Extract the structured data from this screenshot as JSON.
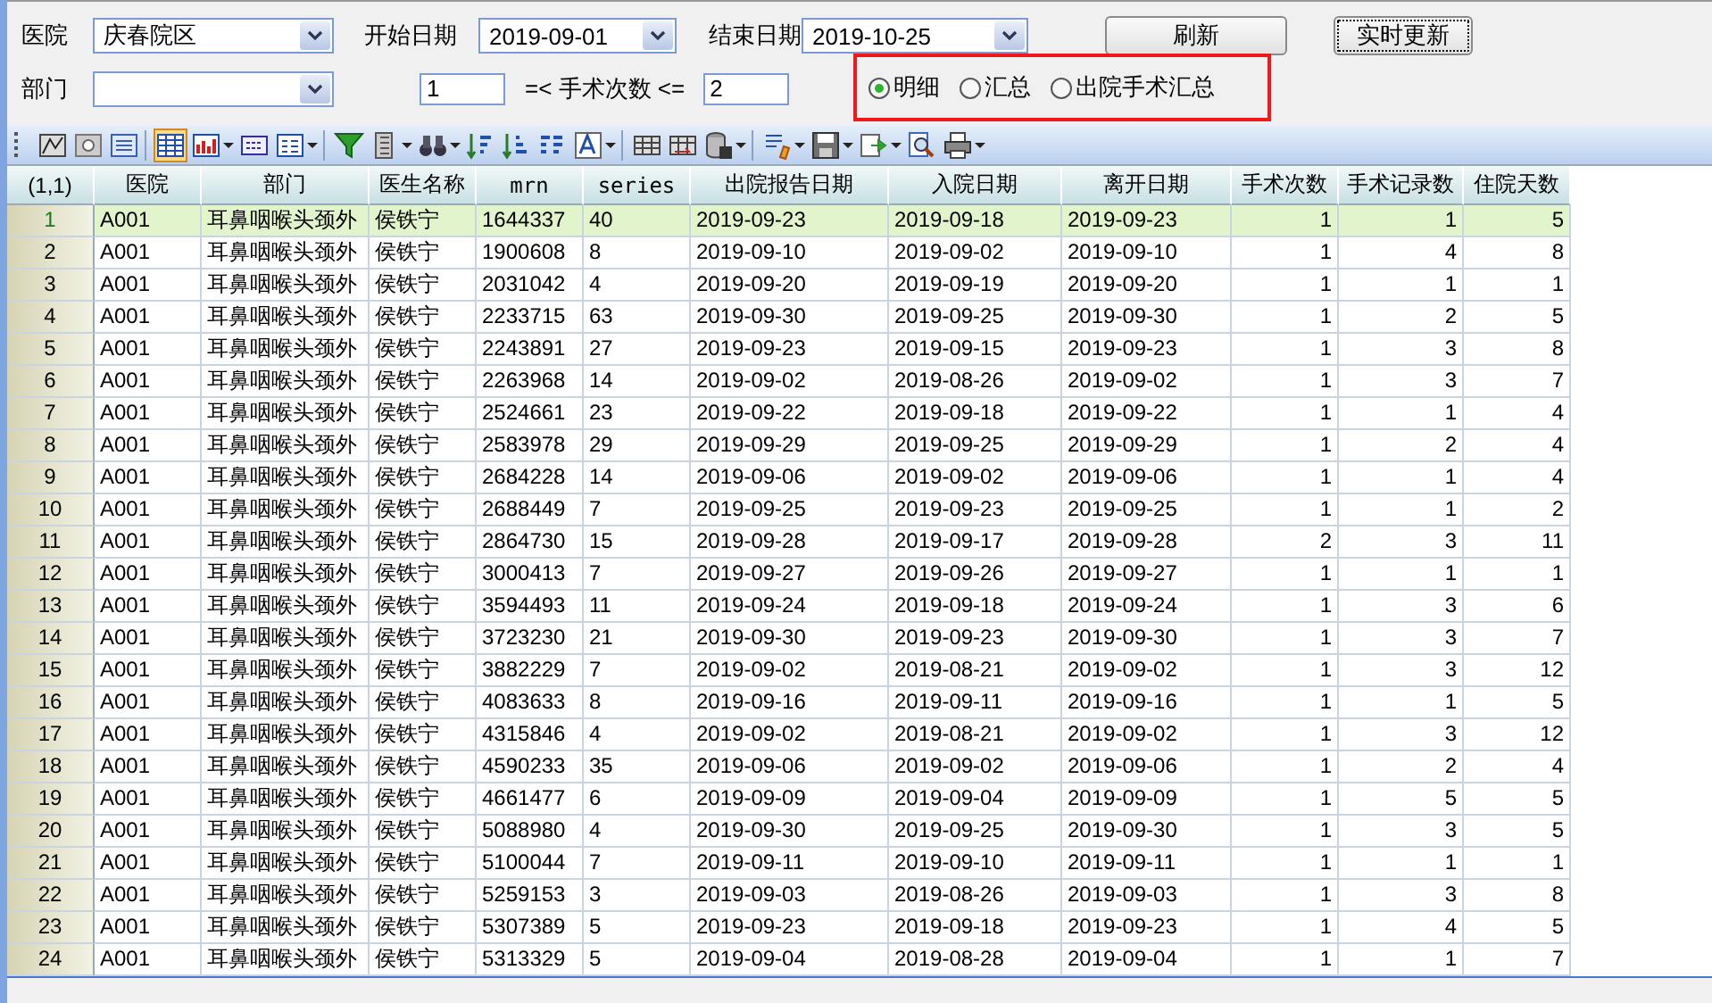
{
  "filters": {
    "hospital": {
      "label": "医院",
      "value": "庆春院区"
    },
    "start_date": {
      "label": "开始日期",
      "value": "2019-09-01"
    },
    "end_date": {
      "label": "结束日期",
      "value": "2019-10-25"
    },
    "department": {
      "label": "部门"
    },
    "min_count": "1",
    "range_label": "=< 手术次数 <=",
    "max_count": "2"
  },
  "buttons": [
    {
      "label": "刷新",
      "focused": false
    },
    {
      "label": "实时更新",
      "focused": true
    }
  ],
  "view_options": [
    {
      "label": "明细",
      "selected": true
    },
    {
      "label": "汇总",
      "selected": false
    },
    {
      "label": "出院手术汇总",
      "selected": false
    }
  ],
  "table": {
    "corner": "(1,1)",
    "columns": [
      {
        "label": "医院",
        "kind": "text"
      },
      {
        "label": "部门",
        "kind": "text"
      },
      {
        "label": "医生名称",
        "kind": "text"
      },
      {
        "label": "mrn",
        "kind": "code"
      },
      {
        "label": "series",
        "kind": "code"
      },
      {
        "label": "出院报告日期",
        "kind": "text"
      },
      {
        "label": "入院日期",
        "kind": "text"
      },
      {
        "label": "离开日期",
        "kind": "text"
      },
      {
        "label": "手术次数",
        "kind": "count"
      },
      {
        "label": "手术记录数",
        "kind": "count"
      },
      {
        "label": "住院天数",
        "kind": "count"
      }
    ],
    "rows": [
      {
        "number": "1",
        "selected": true,
        "cells": [
          "A001",
          "耳鼻咽喉头颈外",
          "侯铁宁",
          "1644337",
          "40",
          "2019-09-23",
          "2019-09-18",
          "2019-09-23",
          "1",
          "1",
          "5"
        ]
      },
      {
        "number": "2",
        "selected": false,
        "cells": [
          "A001",
          "耳鼻咽喉头颈外",
          "侯铁宁",
          "1900608",
          "8",
          "2019-09-10",
          "2019-09-02",
          "2019-09-10",
          "1",
          "4",
          "8"
        ]
      },
      {
        "number": "3",
        "selected": false,
        "cells": [
          "A001",
          "耳鼻咽喉头颈外",
          "侯铁宁",
          "2031042",
          "4",
          "2019-09-20",
          "2019-09-19",
          "2019-09-20",
          "1",
          "1",
          "1"
        ]
      },
      {
        "number": "4",
        "selected": false,
        "cells": [
          "A001",
          "耳鼻咽喉头颈外",
          "侯铁宁",
          "2233715",
          "63",
          "2019-09-30",
          "2019-09-25",
          "2019-09-30",
          "1",
          "2",
          "5"
        ]
      },
      {
        "number": "5",
        "selected": false,
        "cells": [
          "A001",
          "耳鼻咽喉头颈外",
          "侯铁宁",
          "2243891",
          "27",
          "2019-09-23",
          "2019-09-15",
          "2019-09-23",
          "1",
          "3",
          "8"
        ]
      },
      {
        "number": "6",
        "selected": false,
        "cells": [
          "A001",
          "耳鼻咽喉头颈外",
          "侯铁宁",
          "2263968",
          "14",
          "2019-09-02",
          "2019-08-26",
          "2019-09-02",
          "1",
          "3",
          "7"
        ]
      },
      {
        "number": "7",
        "selected": false,
        "cells": [
          "A001",
          "耳鼻咽喉头颈外",
          "侯铁宁",
          "2524661",
          "23",
          "2019-09-22",
          "2019-09-18",
          "2019-09-22",
          "1",
          "1",
          "4"
        ]
      },
      {
        "number": "8",
        "selected": false,
        "cells": [
          "A001",
          "耳鼻咽喉头颈外",
          "侯铁宁",
          "2583978",
          "29",
          "2019-09-29",
          "2019-09-25",
          "2019-09-29",
          "1",
          "2",
          "4"
        ]
      },
      {
        "number": "9",
        "selected": false,
        "cells": [
          "A001",
          "耳鼻咽喉头颈外",
          "侯铁宁",
          "2684228",
          "14",
          "2019-09-06",
          "2019-09-02",
          "2019-09-06",
          "1",
          "1",
          "4"
        ]
      },
      {
        "number": "10",
        "selected": false,
        "cells": [
          "A001",
          "耳鼻咽喉头颈外",
          "侯铁宁",
          "2688449",
          "7",
          "2019-09-25",
          "2019-09-23",
          "2019-09-25",
          "1",
          "1",
          "2"
        ]
      },
      {
        "number": "11",
        "selected": false,
        "cells": [
          "A001",
          "耳鼻咽喉头颈外",
          "侯铁宁",
          "2864730",
          "15",
          "2019-09-28",
          "2019-09-17",
          "2019-09-28",
          "2",
          "3",
          "11"
        ]
      },
      {
        "number": "12",
        "selected": false,
        "cells": [
          "A001",
          "耳鼻咽喉头颈外",
          "侯铁宁",
          "3000413",
          "7",
          "2019-09-27",
          "2019-09-26",
          "2019-09-27",
          "1",
          "1",
          "1"
        ]
      },
      {
        "number": "13",
        "selected": false,
        "cells": [
          "A001",
          "耳鼻咽喉头颈外",
          "侯铁宁",
          "3594493",
          "11",
          "2019-09-24",
          "2019-09-18",
          "2019-09-24",
          "1",
          "3",
          "6"
        ]
      },
      {
        "number": "14",
        "selected": false,
        "cells": [
          "A001",
          "耳鼻咽喉头颈外",
          "侯铁宁",
          "3723230",
          "21",
          "2019-09-30",
          "2019-09-23",
          "2019-09-30",
          "1",
          "3",
          "7"
        ]
      },
      {
        "number": "15",
        "selected": false,
        "cells": [
          "A001",
          "耳鼻咽喉头颈外",
          "侯铁宁",
          "3882229",
          "7",
          "2019-09-02",
          "2019-08-21",
          "2019-09-02",
          "1",
          "3",
          "12"
        ]
      },
      {
        "number": "16",
        "selected": false,
        "cells": [
          "A001",
          "耳鼻咽喉头颈外",
          "侯铁宁",
          "4083633",
          "8",
          "2019-09-16",
          "2019-09-11",
          "2019-09-16",
          "1",
          "1",
          "5"
        ]
      },
      {
        "number": "17",
        "selected": false,
        "cells": [
          "A001",
          "耳鼻咽喉头颈外",
          "侯铁宁",
          "4315846",
          "4",
          "2019-09-02",
          "2019-08-21",
          "2019-09-02",
          "1",
          "3",
          "12"
        ]
      },
      {
        "number": "18",
        "selected": false,
        "cells": [
          "A001",
          "耳鼻咽喉头颈外",
          "侯铁宁",
          "4590233",
          "35",
          "2019-09-06",
          "2019-09-02",
          "2019-09-06",
          "1",
          "2",
          "4"
        ]
      },
      {
        "number": "19",
        "selected": false,
        "cells": [
          "A001",
          "耳鼻咽喉头颈外",
          "侯铁宁",
          "4661477",
          "6",
          "2019-09-09",
          "2019-09-04",
          "2019-09-09",
          "1",
          "5",
          "5"
        ]
      },
      {
        "number": "20",
        "selected": false,
        "cells": [
          "A001",
          "耳鼻咽喉头颈外",
          "侯铁宁",
          "5088980",
          "4",
          "2019-09-30",
          "2019-09-25",
          "2019-09-30",
          "1",
          "3",
          "5"
        ]
      },
      {
        "number": "21",
        "selected": false,
        "cells": [
          "A001",
          "耳鼻咽喉头颈外",
          "侯铁宁",
          "5100044",
          "7",
          "2019-09-11",
          "2019-09-10",
          "2019-09-11",
          "1",
          "1",
          "1"
        ]
      },
      {
        "number": "22",
        "selected": false,
        "cells": [
          "A001",
          "耳鼻咽喉头颈外",
          "侯铁宁",
          "5259153",
          "3",
          "2019-09-03",
          "2019-08-26",
          "2019-09-03",
          "1",
          "3",
          "8"
        ]
      },
      {
        "number": "23",
        "selected": false,
        "cells": [
          "A001",
          "耳鼻咽喉头颈外",
          "侯铁宁",
          "5307389",
          "5",
          "2019-09-23",
          "2019-09-18",
          "2019-09-23",
          "1",
          "4",
          "5"
        ]
      },
      {
        "number": "24",
        "selected": false,
        "cells": [
          "A001",
          "耳鼻咽喉头颈外",
          "侯铁宁",
          "5313329",
          "5",
          "2019-09-04",
          "2019-08-28",
          "2019-09-04",
          "1",
          "1",
          "7"
        ]
      }
    ]
  }
}
